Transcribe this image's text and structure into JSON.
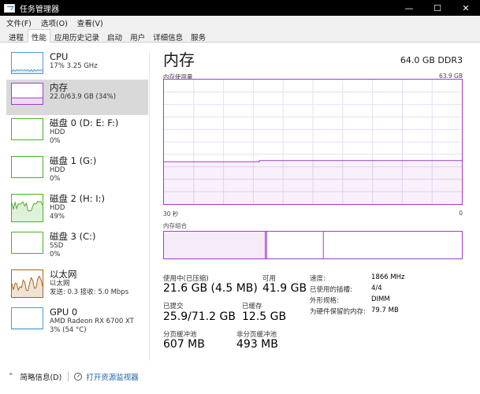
{
  "window": {
    "title": "任务管理器",
    "minimize": "—",
    "maximize": "☐",
    "close": "✕"
  },
  "menu": [
    "文件(F)",
    "选项(O)",
    "查看(V)"
  ],
  "tabs": [
    "进程",
    "性能",
    "应用历史记录",
    "启动",
    "用户",
    "详细信息",
    "服务"
  ],
  "active_tab": 1,
  "colors": {
    "cpu": "#4f9bd0",
    "memory": "#a23cc6",
    "disk": "#4caf2a",
    "ethernet": "#a9661d",
    "gpu": "#4f9bd0"
  },
  "sidebar": [
    {
      "name": "CPU",
      "sub1": "17% 3.25 GHz",
      "sub2": "",
      "sub3": "",
      "kind": "cpu",
      "level": 0.17
    },
    {
      "name": "内存",
      "sub1": "22.0/63.9 GB (34%)",
      "sub2": "",
      "sub3": "",
      "kind": "memory",
      "level": 0.34
    },
    {
      "name": "磁盘 0 (D: E: F:)",
      "sub1": "HDD",
      "sub2": "0%",
      "sub3": "",
      "kind": "disk",
      "level": 0.0
    },
    {
      "name": "磁盘 1 (G:)",
      "sub1": "HDD",
      "sub2": "0%",
      "sub3": "",
      "kind": "disk",
      "level": 0.0
    },
    {
      "name": "磁盘 2 (H: I:)",
      "sub1": "HDD",
      "sub2": "49%",
      "sub3": "",
      "kind": "disk-active",
      "level": 0.49
    },
    {
      "name": "磁盘 3 (C:)",
      "sub1": "SSD",
      "sub2": "0%",
      "sub3": "",
      "kind": "disk",
      "level": 0.0
    },
    {
      "name": "以太网",
      "sub1": "以太网",
      "sub2": "发送: 0.3  接收: 5.0 Mbps",
      "sub3": "",
      "kind": "ethernet",
      "level": 0.5
    },
    {
      "name": "GPU 0",
      "sub1": "AMD Radeon RX 6700 XT",
      "sub2": "3% (54 °C)",
      "sub3": "",
      "kind": "gpu",
      "level": 0.03
    }
  ],
  "main": {
    "title": "内存",
    "spec": "64.0 GB DDR3",
    "usage_label": "内存使用量",
    "usage_max": "63.9 GB",
    "time_left": "30 秒",
    "time_right": "0",
    "usage_fraction": 0.34,
    "composition_label": "内存组合",
    "composition": {
      "in_use_fraction": 0.34,
      "modified_fraction": 0.005,
      "standby_fraction": 0.19
    }
  },
  "stats": {
    "in_use_label": "使用中(已压缩)",
    "in_use_value": "21.6 GB (4.5 MB)",
    "available_label": "可用",
    "available_value": "41.9 GB",
    "committed_label": "已提交",
    "committed_value": "25.9/71.2 GB",
    "cached_label": "已缓存",
    "cached_value": "12.5 GB",
    "paged_label": "分页缓冲池",
    "paged_value": "607 MB",
    "nonpaged_label": "非分页缓冲池",
    "nonpaged_value": "493 MB"
  },
  "details": [
    {
      "label": "速度:",
      "value": "1866 MHz"
    },
    {
      "label": "已使用的插槽:",
      "value": "4/4"
    },
    {
      "label": "外形规格:",
      "value": "DIMM"
    },
    {
      "label": "为硬件保留的内存:",
      "value": "79.7 MB"
    }
  ],
  "footer": {
    "summary": "简略信息(D)",
    "link": "打开资源监视器"
  }
}
